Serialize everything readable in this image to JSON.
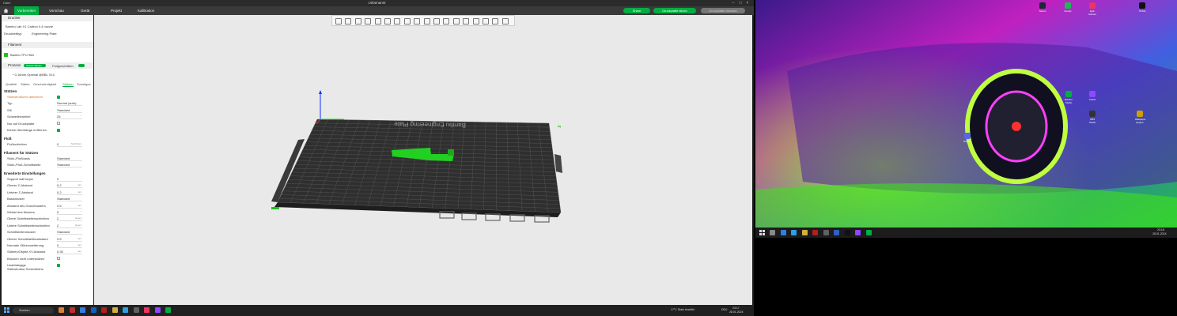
{
  "window": {
    "title": "Unbenannt",
    "title_left": "Datei"
  },
  "navbar": {
    "tabs": [
      "Vorbereiten",
      "Vorschau",
      "Gerät",
      "Projekt",
      "Kalibration"
    ],
    "active_tab": 0,
    "share_label": "Share",
    "slice_label": "Druckplatte slicen",
    "print_label": "Druckplatte drucken",
    "accent": "#00ae42"
  },
  "sidebar": {
    "printer_header": "Drucker",
    "printer_name": "Bambu Lab X1 Carbon 0.4 nozzle",
    "plate_type_label": "Druckbetttyp",
    "plate_type_value": "Engineering Plate",
    "filament_header": "Filament",
    "filament_name": "Bambu TPU 95A",
    "process_header": "Prozess",
    "process_pill_a": "Global",
    "process_pill_b": "Objekte",
    "advanced_label": "Fortgeschritten",
    "preset_name": "* 0.16mm Optimal @BBL X1C",
    "tabs": [
      "Qualität",
      "Stärke",
      "Geschwindigkeit",
      "Stützen",
      "Sonstiges"
    ],
    "active_tab": 3,
    "groups": {
      "supports": "Stützen",
      "raft": "Floß",
      "filament_supports": "Filament für Stützen",
      "advanced": "Erweiterte Einstellungen"
    },
    "rows_supports": [
      {
        "label": "Stützstrukturen aktivieren",
        "type": "check",
        "checked": true,
        "highlight": true
      },
      {
        "label": "Typ",
        "type": "value",
        "value": "Normal (auto)"
      },
      {
        "label": "Stil",
        "type": "value",
        "value": "Standard"
      },
      {
        "label": "Schwellenwinkel",
        "type": "value",
        "value": "25",
        "unit": "°"
      },
      {
        "label": "Nur auf Druckplatte",
        "type": "check",
        "checked": false
      },
      {
        "label": "Kleine Überhänge entfernen",
        "type": "check",
        "checked": true
      }
    ],
    "rows_raft": [
      {
        "label": "Floßschichten",
        "type": "value",
        "value": "0",
        "unit": "Schichten"
      }
    ],
    "rows_filament": [
      {
        "label": "Stütz-/Floßbasis",
        "type": "value",
        "value": "Standard"
      },
      {
        "label": "Stütz-/Floß-Schnittstelle",
        "type": "value",
        "value": "Standard"
      }
    ],
    "rows_advanced": [
      {
        "label": "Support wall loops",
        "type": "value",
        "value": "0"
      },
      {
        "label": "Oberer Z-Abstand",
        "type": "value",
        "value": "0.2",
        "unit": "mm"
      },
      {
        "label": "Unterer Z-Abstand",
        "type": "value",
        "value": "0.2",
        "unit": "mm"
      },
      {
        "label": "Basismuster",
        "type": "value",
        "value": "Standard"
      },
      {
        "label": "Abstand des Grundmusters",
        "type": "value",
        "value": "2.5",
        "unit": "mm"
      },
      {
        "label": "Winkel des Musters",
        "type": "value",
        "value": "0",
        "unit": "°"
      },
      {
        "label": "Obere Schnittstellenschichten",
        "type": "value",
        "value": "2",
        "unit": "layers"
      },
      {
        "label": "Untere Schnittstellenschichten",
        "type": "value",
        "value": "2",
        "unit": "layers"
      },
      {
        "label": "Schnittstellenmuster",
        "type": "value",
        "value": "Standard"
      },
      {
        "label": "Oberer Schnittstellenabstand",
        "type": "value",
        "value": "0.5",
        "unit": "mm"
      },
      {
        "label": "Normale Stützerweiterung",
        "type": "value",
        "value": "0",
        "unit": "mm"
      },
      {
        "label": "Stützen/Objekt XY-Abstand",
        "type": "value",
        "value": "0.35",
        "unit": "mm"
      },
      {
        "label": "Brücken nicht unterstützen",
        "type": "check",
        "checked": false
      },
      {
        "label": "Unabhängige",
        "label2": "Stützstruktur-Schichthöhe",
        "type": "check",
        "checked": true
      }
    ]
  },
  "viewport": {
    "plate_label": "Bambu Engineering Plate",
    "bed_color": "#3a3a3a",
    "model_color": "#22d022"
  },
  "taskbar_left": {
    "search_label": "Suchen",
    "weather": "17°C  Stark bewölkt",
    "time": "23:17",
    "date": "28.01.2024",
    "lang": "DEU"
  },
  "taskbar_right": {
    "time": "23:18",
    "date": "28.01.2024"
  },
  "desktop_icons": [
    {
      "label": "Steam",
      "color": "#1b2838"
    },
    {
      "label": "Spotify",
      "color": "#1db954"
    },
    {
      "label": "Epic Games",
      "color": "#ee3366"
    },
    {
      "label": "TikTok",
      "color": "#111111"
    },
    {
      "label": "Twitch",
      "color": "#9146ff"
    },
    {
      "label": "Bambu Studio",
      "color": "#00ae42"
    },
    {
      "label": "OBS Studio",
      "color": "#333333"
    },
    {
      "label": "Wallpaper Engine",
      "color": "#d0a000"
    },
    {
      "label": "Discord",
      "color": "#5865f2"
    }
  ]
}
